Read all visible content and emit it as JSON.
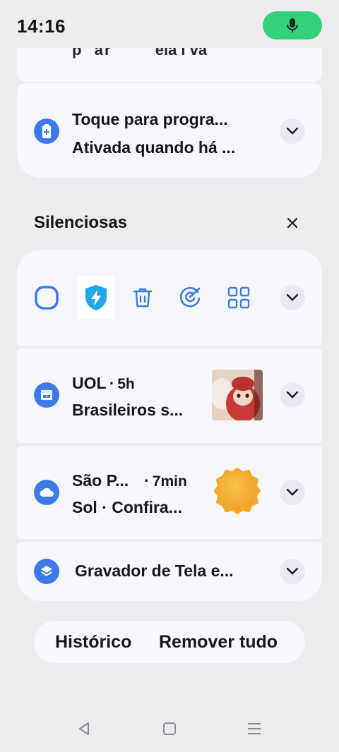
{
  "status_bar": {
    "time": "14:16",
    "mic_icon": "mic-icon",
    "mic_color": "#34d17c"
  },
  "top_card": {
    "cut_text_left": "p",
    "cut_text_mid": "ell",
    "cut_text_right": "ela i va"
  },
  "battery_notification": {
    "icon": "battery-plus-icon",
    "title": "Toque para progra...",
    "subtitle": "Ativada quando há ..."
  },
  "silent_section": {
    "title": "Silenciosas"
  },
  "quick_actions": {
    "icons": [
      "square-icon",
      "shield-bolt-icon",
      "trash-icon",
      "target-icon",
      "grid-icon"
    ]
  },
  "notifications": [
    {
      "app": "UOL",
      "time": "5h",
      "text": "Brasileiros s...",
      "icon": "calendar-icon"
    },
    {
      "app": "São P...",
      "time": "7min",
      "text": "Sol · Confira...",
      "icon": "cloud-icon"
    },
    {
      "app": "Gravador de Tela e...",
      "icon": "layers-icon"
    }
  ],
  "bottom_actions": {
    "history": "Histórico",
    "remove_all": "Remover tudo"
  },
  "colors": {
    "accent": "#3c7ae8",
    "background": "#ececef",
    "card": "#f7f7fb"
  }
}
